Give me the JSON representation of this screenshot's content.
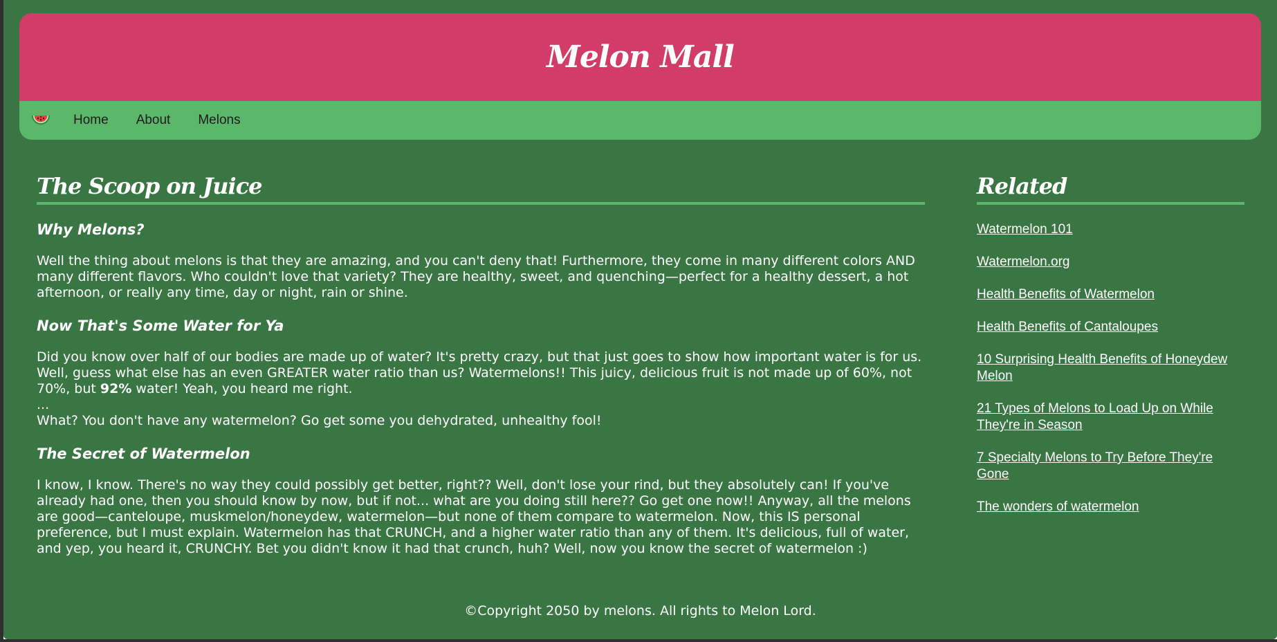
{
  "header": {
    "site_title": "Melon Mall"
  },
  "nav": {
    "logo_icon": "watermelon-icon",
    "items": [
      {
        "label": "Home"
      },
      {
        "label": "About"
      },
      {
        "label": "Melons"
      }
    ]
  },
  "article": {
    "title": "The Scoop on Juice",
    "sections": [
      {
        "heading": "Why Melons?",
        "paragraphs": [
          "Well the thing about melons is that they are amazing, and you can't deny that! Furthermore, they come in many different colors AND many different flavors. Who couldn't love that variety? They are healthy, sweet, and quenching—perfect for a healthy dessert, a hot afternoon, or really any time, day or night, rain or shine."
        ]
      },
      {
        "heading": "Now That's Some Water for Ya",
        "text_before_bold": "Did you know over half of our bodies are made up of water? It's pretty crazy, but that just goes to show how important water is for us. Well, guess what else has an even GREATER water ratio than us? Watermelons!! This juicy, delicious fruit is not made up of 60%, not 70%, but ",
        "bold": "92%",
        "text_after_bold": " water! Yeah, you heard me right.",
        "ellipsis": "...",
        "closing": "What? You don't have any watermelon? Go get some you dehydrated, unhealthy fool!"
      },
      {
        "heading": "The Secret of Watermelon",
        "paragraphs": [
          "I know, I know. There's no way they could possibly get better, right?? Well, don't lose your rind, but they absolutely can! If you've already had one, then you should know by now, but if not... what are you doing still here?? Go get one now!! Anyway, all the melons are good—canteloupe, muskmelon/honeydew, watermelon—but none of them compare to watermelon. Now, this IS personal preference, but I must explain. Watermelon has that CRUNCH, and a higher water ratio than any of them. It's delicious, full of water, and yep, you heard it, CRUNCHY. Bet you didn't know it had that crunch, huh? Well, now you know the secret of watermelon :)"
        ]
      }
    ]
  },
  "sidebar": {
    "title": "Related",
    "links": [
      "Watermelon 101",
      "Watermelon.org",
      "Health Benefits of Watermelon",
      "Health Benefits of Cantaloupes",
      "10 Surprising Health Benefits of Honeydew Melon",
      "21 Types of Melons to Load Up on While They're in Season",
      "7 Specialty Melons to Try Before They're Gone",
      "The wonders of watermelon"
    ]
  },
  "footer": {
    "text": "©Copyright 2050 by melons. All rights to Melon Lord."
  },
  "colors": {
    "background": "#3a7544",
    "banner": "#d23c69",
    "nav": "#5bb86a",
    "text": "#ffffff"
  }
}
